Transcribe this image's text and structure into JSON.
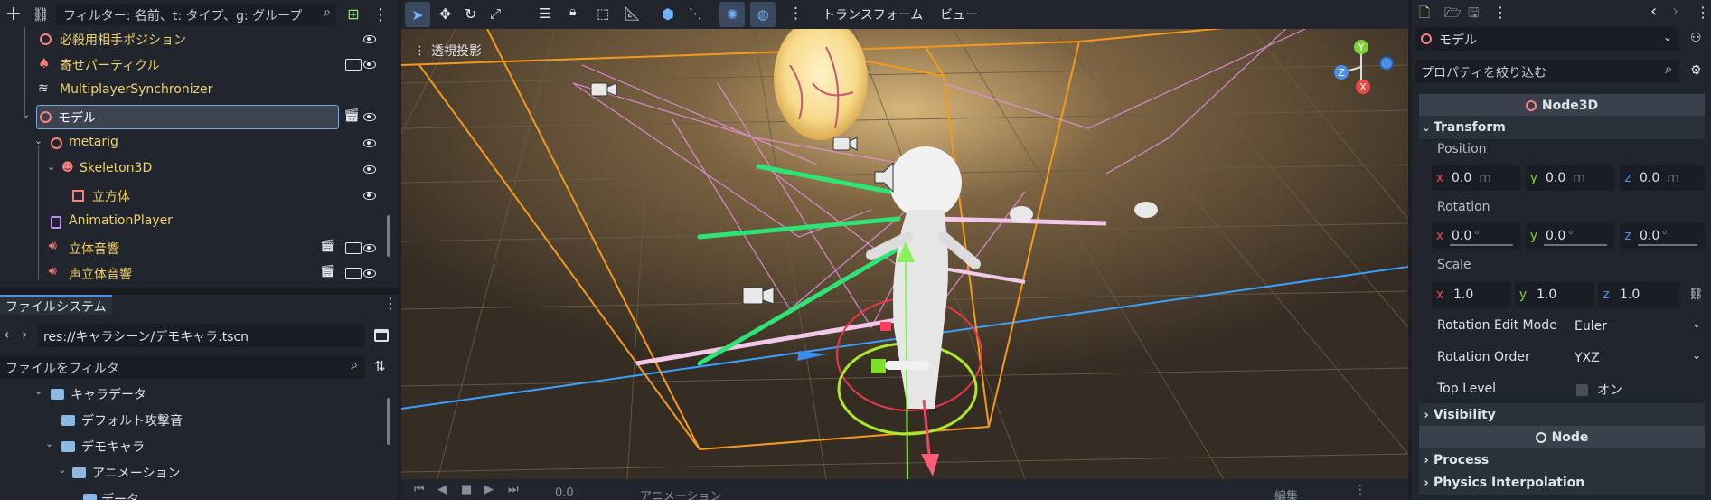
{
  "scene_tree": {
    "filter_placeholder": "フィルター: 名前、t: タイプ、g: グループ",
    "items": [
      {
        "label": "必殺用相手ポジション"
      },
      {
        "label": "寄せパーティクル"
      },
      {
        "label": "MultiplayerSynchronizer"
      },
      {
        "label": "モデル"
      },
      {
        "label": "metarig"
      },
      {
        "label": "Skeleton3D"
      },
      {
        "label": "立方体"
      },
      {
        "label": "AnimationPlayer"
      },
      {
        "label": "立体音響"
      },
      {
        "label": "声立体音響"
      }
    ]
  },
  "filesystem": {
    "tab": "ファイルシステム",
    "path": "res://キャラシーン/デモキャラ.tscn",
    "filter_placeholder": "ファイルをフィルタ",
    "items": [
      {
        "label": "キャラデータ"
      },
      {
        "label": "デフォルト攻撃音"
      },
      {
        "label": "デモキャラ"
      },
      {
        "label": "アニメーション"
      },
      {
        "label": "データ"
      }
    ]
  },
  "viewport": {
    "menu_transform": "トランスフォーム",
    "menu_view": "ビュー",
    "perspective_label": "透視投影",
    "gizmo": {
      "x": "X",
      "y": "Y",
      "z": "Z"
    },
    "anim_time": "0.0",
    "anim_label": "アニメーション",
    "anim_edit": "編集"
  },
  "inspector": {
    "node_selector": "モデル",
    "filter_placeholder": "プロパティを絞り込む",
    "class_header": "Node3D",
    "transform_section": "Transform",
    "position_label": "Position",
    "position": {
      "x": "0.0",
      "y": "0.0",
      "z": "0.0",
      "unit": "m"
    },
    "rotation_label": "Rotation",
    "rotation": {
      "x": "0.0",
      "y": "0.0",
      "z": "0.0",
      "unit": "°"
    },
    "scale_label": "Scale",
    "scale": {
      "x": "1.0",
      "y": "1.0",
      "z": "1.0"
    },
    "rot_edit_mode_label": "Rotation Edit Mode",
    "rot_edit_mode_value": "Euler",
    "rot_order_label": "Rotation Order",
    "rot_order_value": "YXZ",
    "top_level_label": "Top Level",
    "top_level_value": "オン",
    "visibility_section": "Visibility",
    "node_header": "Node",
    "process_section": "Process",
    "physics_section": "Physics Interpolation"
  },
  "colors": {
    "accent": "#4a90e8",
    "node_red": "#fc7f7f",
    "axis_x": "#e84a4a",
    "axis_y": "#7fd13b",
    "axis_z": "#4a90e8",
    "folder": "#8fb8e0"
  }
}
